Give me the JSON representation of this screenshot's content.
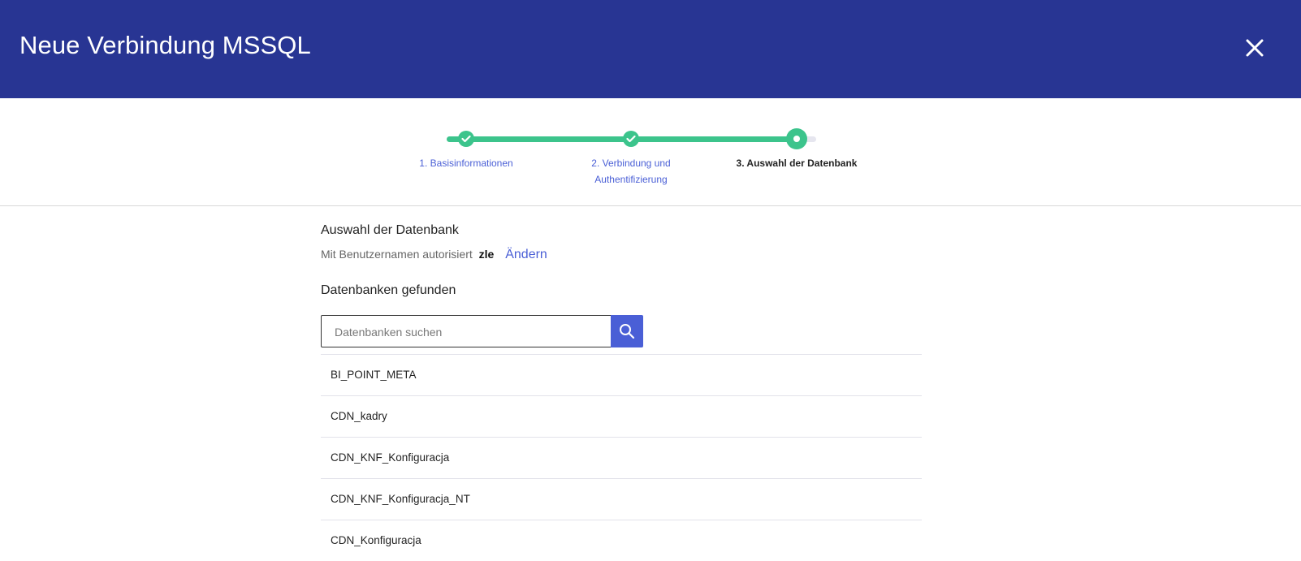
{
  "header": {
    "title": "Neue Verbindung MSSQL"
  },
  "stepper": {
    "steps": [
      {
        "label_line1": "1. Basisinformationen",
        "label_line2": "",
        "status": "done"
      },
      {
        "label_line1": "2. Verbindung und",
        "label_line2": "Authentifizierung",
        "status": "done"
      },
      {
        "label_line1": "3. Auswahl der Datenbank",
        "label_line2": "",
        "status": "current"
      }
    ]
  },
  "main": {
    "title": "Auswahl der Datenbank",
    "auth_text": "Mit Benutzernamen autorisiert",
    "auth_user": "zle",
    "change_link": "Ändern",
    "found_title": "Datenbanken gefunden",
    "search": {
      "placeholder": "Datenbanken suchen",
      "value": ""
    },
    "databases": [
      "BI_POINT_META",
      "CDN_kadry",
      "CDN_KNF_Konfiguracja",
      "CDN_KNF_Konfiguracja_NT",
      "CDN_Konfiguracja"
    ]
  },
  "colors": {
    "header_bg": "#283593",
    "accent": "#4a5fd6",
    "success": "#3cc48c"
  },
  "icons": {
    "close": "close-icon",
    "check": "check-icon",
    "search": "search-icon"
  }
}
